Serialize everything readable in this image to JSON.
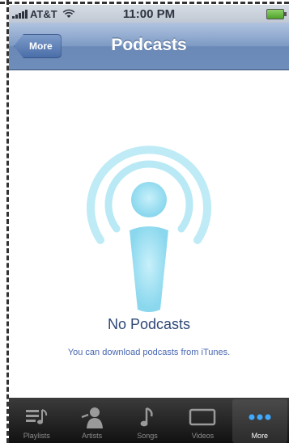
{
  "status_bar": {
    "carrier": "AT&T",
    "time": "11:00 PM"
  },
  "nav": {
    "back_label": "More",
    "title": "Podcasts"
  },
  "empty_state": {
    "title": "No Podcasts",
    "message": "You can download podcasts from iTunes."
  },
  "tabs": [
    {
      "label": "Playlists",
      "icon": "playlists-icon"
    },
    {
      "label": "Artists",
      "icon": "artists-icon"
    },
    {
      "label": "Songs",
      "icon": "songs-icon"
    },
    {
      "label": "Videos",
      "icon": "videos-icon"
    },
    {
      "label": "More",
      "icon": "more-icon",
      "active": true
    }
  ],
  "colors": {
    "nav_bar": "#7d9ac4",
    "podcast_glow": "#a8e4f2",
    "tab_bar": "#1e1e1e",
    "more_dots": "#3fa9ff"
  }
}
